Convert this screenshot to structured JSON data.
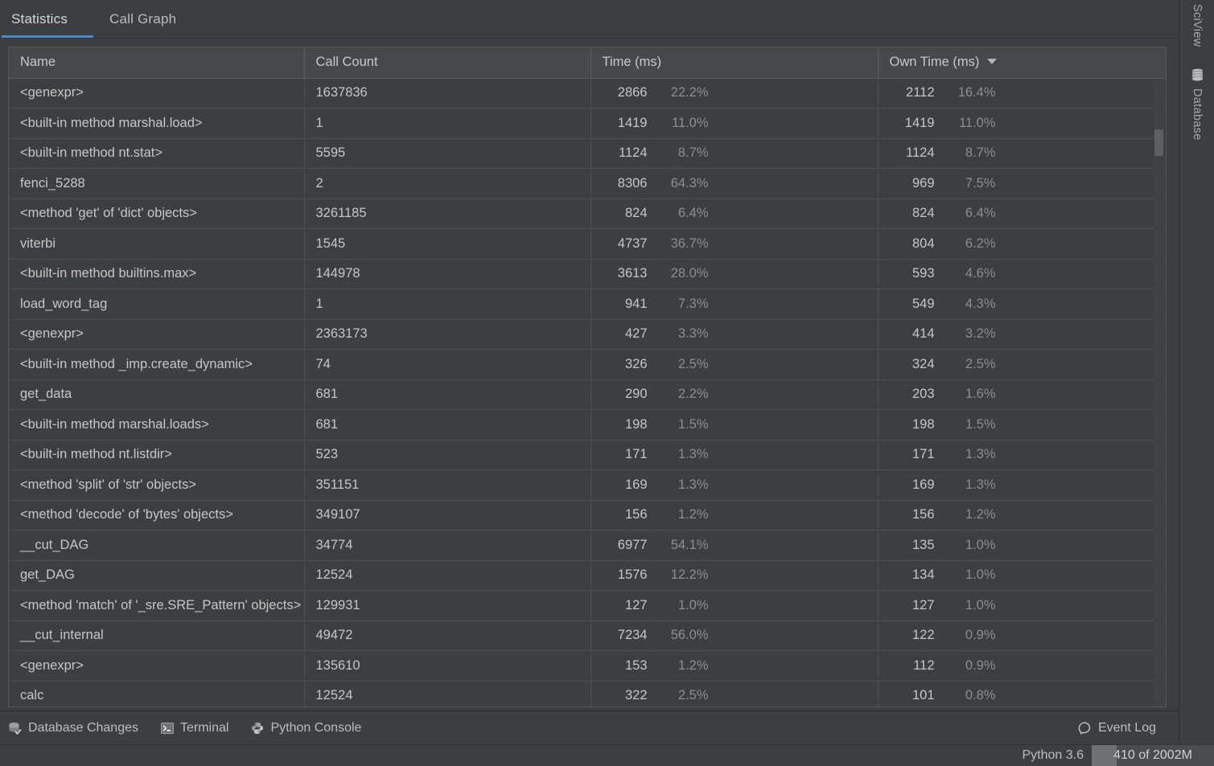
{
  "tabs": [
    {
      "label": "Statistics",
      "active": true
    },
    {
      "label": "Call Graph",
      "active": false
    }
  ],
  "table": {
    "columns": [
      {
        "label": "Name",
        "sorted": false
      },
      {
        "label": "Call Count",
        "sorted": false
      },
      {
        "label": "Time (ms)",
        "sorted": false
      },
      {
        "label": "Own Time (ms)",
        "sorted": true,
        "sort_dir": "desc"
      }
    ],
    "rows": [
      {
        "name": "<genexpr>",
        "call_count": "1637836",
        "time": "2866",
        "time_pct": "22.2%",
        "own_time": "2112",
        "own_pct": "16.4%"
      },
      {
        "name": "<built-in method marshal.load>",
        "call_count": "1",
        "time": "1419",
        "time_pct": "11.0%",
        "own_time": "1419",
        "own_pct": "11.0%"
      },
      {
        "name": "<built-in method nt.stat>",
        "call_count": "5595",
        "time": "1124",
        "time_pct": "8.7%",
        "own_time": "1124",
        "own_pct": "8.7%"
      },
      {
        "name": "fenci_5288",
        "call_count": "2",
        "time": "8306",
        "time_pct": "64.3%",
        "own_time": "969",
        "own_pct": "7.5%"
      },
      {
        "name": "<method 'get' of 'dict' objects>",
        "call_count": "3261185",
        "time": "824",
        "time_pct": "6.4%",
        "own_time": "824",
        "own_pct": "6.4%"
      },
      {
        "name": "viterbi",
        "call_count": "1545",
        "time": "4737",
        "time_pct": "36.7%",
        "own_time": "804",
        "own_pct": "6.2%"
      },
      {
        "name": "<built-in method builtins.max>",
        "call_count": "144978",
        "time": "3613",
        "time_pct": "28.0%",
        "own_time": "593",
        "own_pct": "4.6%"
      },
      {
        "name": "load_word_tag",
        "call_count": "1",
        "time": "941",
        "time_pct": "7.3%",
        "own_time": "549",
        "own_pct": "4.3%"
      },
      {
        "name": "<genexpr>",
        "call_count": "2363173",
        "time": "427",
        "time_pct": "3.3%",
        "own_time": "414",
        "own_pct": "3.2%"
      },
      {
        "name": "<built-in method _imp.create_dynamic>",
        "call_count": "74",
        "time": "326",
        "time_pct": "2.5%",
        "own_time": "324",
        "own_pct": "2.5%"
      },
      {
        "name": "get_data",
        "call_count": "681",
        "time": "290",
        "time_pct": "2.2%",
        "own_time": "203",
        "own_pct": "1.6%"
      },
      {
        "name": "<built-in method marshal.loads>",
        "call_count": "681",
        "time": "198",
        "time_pct": "1.5%",
        "own_time": "198",
        "own_pct": "1.5%"
      },
      {
        "name": "<built-in method nt.listdir>",
        "call_count": "523",
        "time": "171",
        "time_pct": "1.3%",
        "own_time": "171",
        "own_pct": "1.3%"
      },
      {
        "name": "<method 'split' of 'str' objects>",
        "call_count": "351151",
        "time": "169",
        "time_pct": "1.3%",
        "own_time": "169",
        "own_pct": "1.3%"
      },
      {
        "name": "<method 'decode' of 'bytes' objects>",
        "call_count": "349107",
        "time": "156",
        "time_pct": "1.2%",
        "own_time": "156",
        "own_pct": "1.2%"
      },
      {
        "name": "__cut_DAG",
        "call_count": "34774",
        "time": "6977",
        "time_pct": "54.1%",
        "own_time": "135",
        "own_pct": "1.0%"
      },
      {
        "name": "get_DAG",
        "call_count": "12524",
        "time": "1576",
        "time_pct": "12.2%",
        "own_time": "134",
        "own_pct": "1.0%"
      },
      {
        "name": "<method 'match' of '_sre.SRE_Pattern' objects>",
        "call_count": "129931",
        "time": "127",
        "time_pct": "1.0%",
        "own_time": "127",
        "own_pct": "1.0%"
      },
      {
        "name": "__cut_internal",
        "call_count": "49472",
        "time": "7234",
        "time_pct": "56.0%",
        "own_time": "122",
        "own_pct": "0.9%"
      },
      {
        "name": "<genexpr>",
        "call_count": "135610",
        "time": "153",
        "time_pct": "1.2%",
        "own_time": "112",
        "own_pct": "0.9%"
      },
      {
        "name": "calc",
        "call_count": "12524",
        "time": "322",
        "time_pct": "2.5%",
        "own_time": "101",
        "own_pct": "0.8%"
      }
    ]
  },
  "right_sidebar": {
    "items": [
      {
        "label": "SciView",
        "icon": null
      },
      {
        "label": "Database",
        "icon": "database-icon"
      }
    ]
  },
  "statusbar": {
    "items": [
      {
        "label": "Database Changes",
        "icon": "database-changes-icon"
      },
      {
        "label": "Terminal",
        "icon": "terminal-icon"
      },
      {
        "label": "Python Console",
        "icon": "python-icon"
      }
    ],
    "event_log": {
      "label": "Event Log",
      "icon": "event-log-icon"
    }
  },
  "bottombar": {
    "python_version": "Python 3.6",
    "memory": "410 of 2002M"
  },
  "colors": {
    "accent": "#4a88c7",
    "background": "#3c3f41",
    "header_background": "#45494a",
    "text": "#c6c6c6",
    "muted_text": "#8b8d8e"
  }
}
